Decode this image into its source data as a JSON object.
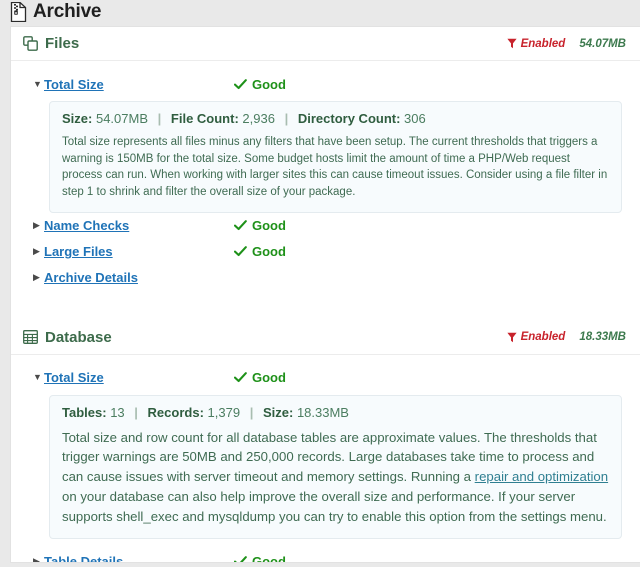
{
  "page": {
    "title": "Archive",
    "title_icon": "file-archive-icon"
  },
  "sections": [
    {
      "id": "files",
      "name": "Files",
      "icon": "files-copy-icon",
      "filter_icon": "funnel-icon",
      "filter_status": "Enabled",
      "size": "54.07MB",
      "rows": [
        {
          "id": "files-total-size",
          "label": "Total Size",
          "expanded": true,
          "toggle": "▼",
          "status": "Good",
          "status_icon": "check-icon",
          "detail": {
            "stats": [
              {
                "label": "Size:",
                "value": "54.07MB"
              },
              {
                "label": "File Count:",
                "value": "2,936"
              },
              {
                "label": "Directory Count:",
                "value": "306"
              }
            ],
            "separator": "|",
            "text_before": "Total size represents all files minus any filters that have been setup. The current thresholds that triggers a warning is 150MB for the total size. Some budget hosts limit the amount of time a PHP/Web request process can run. When working with larger sites this can cause timeout issues. Consider using a file filter in step 1 to shrink and filter the overall size of your package.",
            "link_text": "",
            "text_after": ""
          }
        },
        {
          "id": "files-name-checks",
          "label": "Name Checks",
          "expanded": false,
          "toggle": "▶",
          "status": "Good",
          "status_icon": "check-icon"
        },
        {
          "id": "files-large-files",
          "label": "Large Files",
          "expanded": false,
          "toggle": "▶",
          "status": "Good",
          "status_icon": "check-icon"
        },
        {
          "id": "files-archive-details",
          "label": "Archive Details",
          "expanded": false,
          "toggle": "▶",
          "status": "",
          "status_icon": ""
        }
      ]
    },
    {
      "id": "database",
      "name": "Database",
      "icon": "table-grid-icon",
      "filter_icon": "funnel-icon",
      "filter_status": "Enabled",
      "size": "18.33MB",
      "rows": [
        {
          "id": "database-total-size",
          "label": "Total Size",
          "expanded": true,
          "toggle": "▼",
          "status": "Good",
          "status_icon": "check-icon",
          "detail": {
            "stats": [
              {
                "label": "Tables:",
                "value": "13"
              },
              {
                "label": "Records:",
                "value": "1,379"
              },
              {
                "label": "Size:",
                "value": "18.33MB"
              }
            ],
            "separator": "|",
            "text_before": "Total size and row count for all database tables are approximate values. The thresholds that trigger warnings are 50MB and 250,000 records. Large databases take time to process and can cause issues with server timeout and memory settings. Running a ",
            "link_text": "repair and optimization",
            "text_after": " on your database can also help improve the overall size and performance. If your server supports shell_exec and mysqldump you can try to enable this option from the settings menu."
          }
        },
        {
          "id": "database-table-details",
          "label": "Table Details",
          "expanded": false,
          "toggle": "▶",
          "status": "Good",
          "status_icon": "check-icon"
        }
      ]
    }
  ],
  "colors": {
    "link": "#1f73b7",
    "status_good": "#1e9119",
    "enabled": "#c8232c",
    "size": "#3d7a4e",
    "section_title": "#3d6b4b",
    "detail_text": "#3f6b52"
  }
}
